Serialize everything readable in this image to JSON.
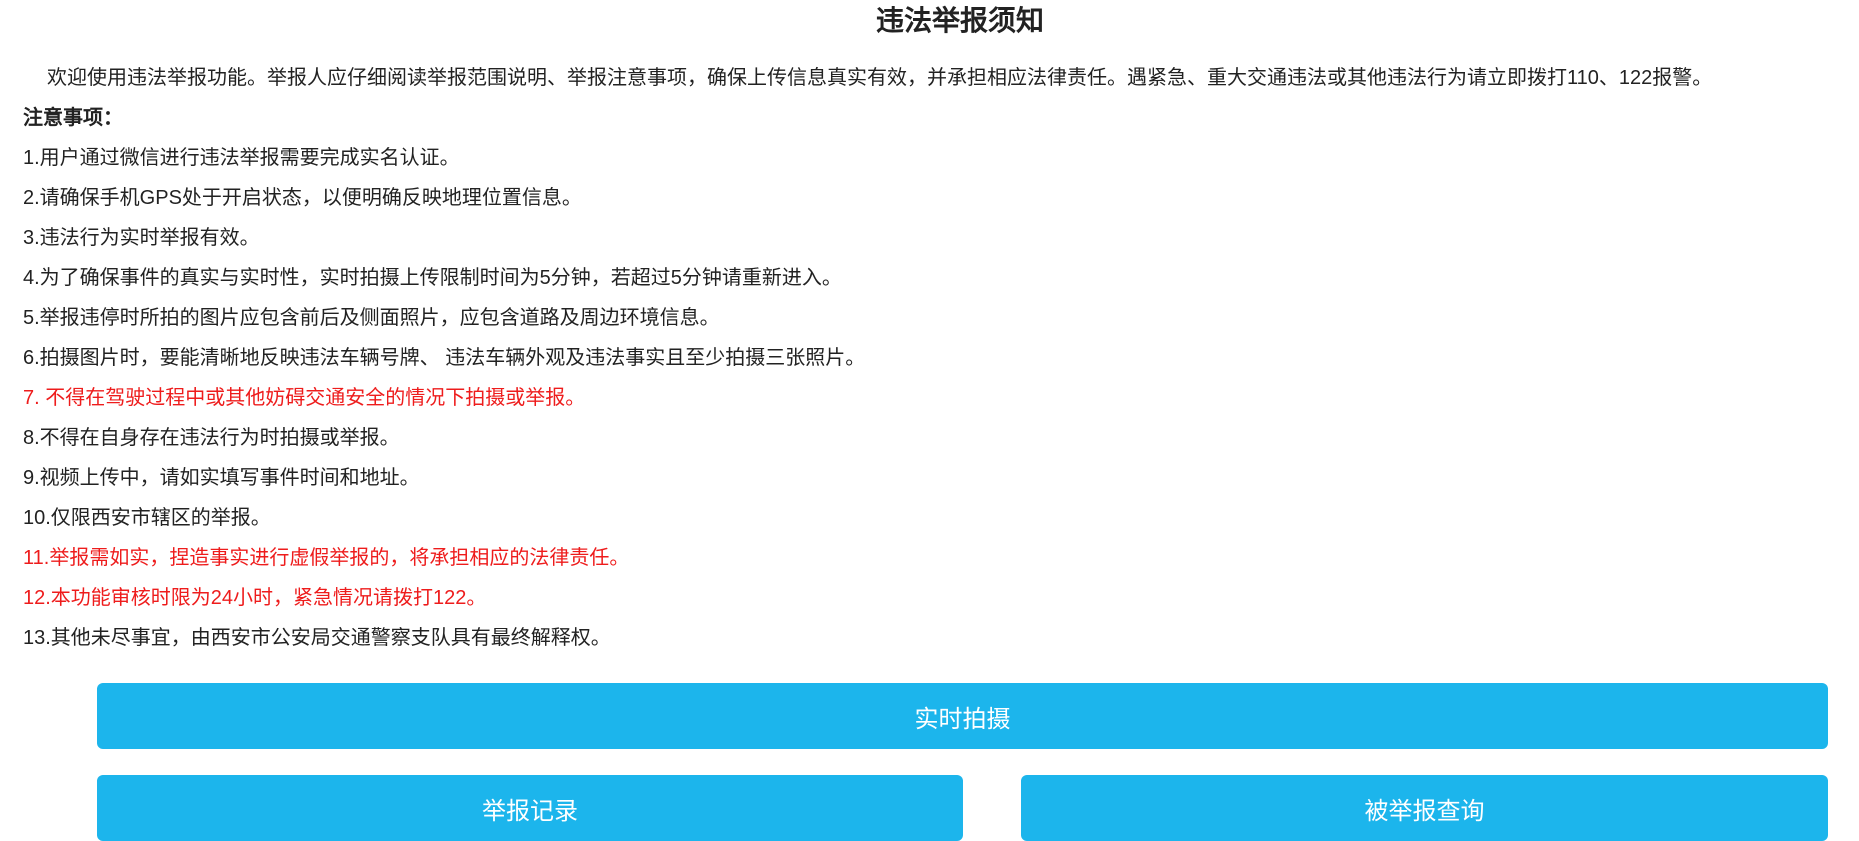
{
  "page": {
    "title": "违法举报须知"
  },
  "notice": {
    "intro": "欢迎使用违法举报功能。举报人应仔细阅读举报范围说明、举报注意事项，确保上传信息真实有效，并承担相应法律责任。遇紧急、重大交通违法或其他违法行为请立即拨打110、122报警。",
    "section_label": "注意事项：",
    "items": [
      "1.用户通过微信进行违法举报需要完成实名认证。",
      "2.请确保手机GPS处于开启状态，以便明确反映地理位置信息。",
      "3.违法行为实时举报有效。",
      "4.为了确保事件的真实与实时性，实时拍摄上传限制时间为5分钟，若超过5分钟请重新进入。",
      "5.举报违停时所拍的图片应包含前后及侧面照片，应包含道路及周边环境信息。",
      "6.拍摄图片时，要能清晰地反映违法车辆号牌、 违法车辆外观及违法事实且至少拍摄三张照片。",
      "7. 不得在驾驶过程中或其他妨碍交通安全的情况下拍摄或举报。",
      "8.不得在自身存在违法行为时拍摄或举报。",
      "9.视频上传中，请如实填写事件时间和地址。",
      "10.仅限西安市辖区的举报。",
      "11.举报需如实，捏造事实进行虚假举报的，将承担相应的法律责任。",
      "12.本功能审核时限为24小时，紧急情况请拨打122。",
      "13.其他未尽事宜，由西安市公安局交通警察支队具有最终解释权。"
    ]
  },
  "buttons": {
    "capture": "实时拍摄",
    "records": "举报记录",
    "reported_query": "被举报查询"
  },
  "colors": {
    "button_bg": "#1cb5ec",
    "warning_text": "#ee1c1c",
    "body_text": "#222222"
  }
}
